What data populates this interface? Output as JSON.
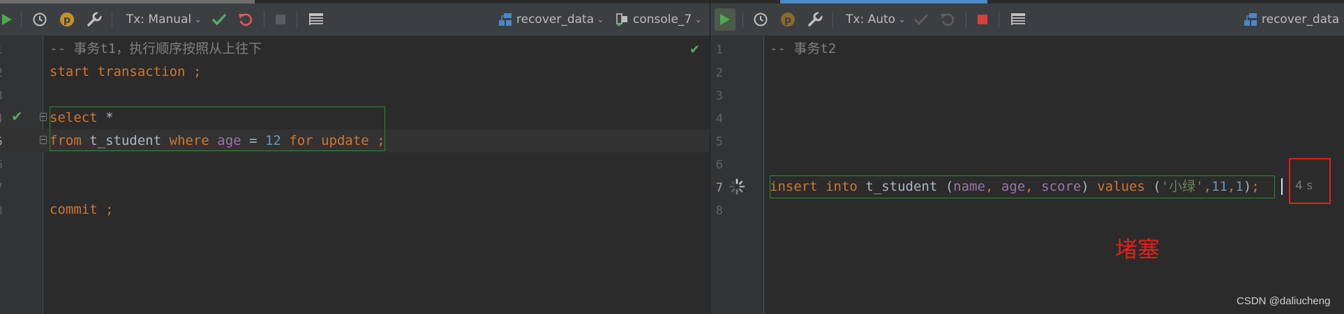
{
  "colors": {
    "editor_bg": "#2b2b2b",
    "toolbar_bg": "#3c3f41",
    "keyword": "#cc7832",
    "column": "#9876aa",
    "number": "#6897bb",
    "string": "#6a8759",
    "comment": "#808080",
    "ok_green": "#59a869",
    "run_green": "#4eaa4e",
    "rollback_red": "#e25757",
    "stop_red": "#d8403b",
    "annotation_red": "#e0201b",
    "active_tab_blue": "#4a88c7"
  },
  "left": {
    "toolbar": {
      "tx_mode": "Tx: Manual",
      "datasource": "recover_data",
      "console": "console_7",
      "icons": [
        "run-icon",
        "history-icon",
        "p-icon",
        "wrench-icon",
        "commit-check-icon",
        "rollback-icon",
        "stop-icon",
        "table-icon",
        "datasource-icon",
        "console-icon",
        "chevron-down-icon"
      ]
    },
    "editor": {
      "line_numbers": [
        "1",
        "2",
        "3",
        "4",
        "5",
        "6",
        "7",
        "8"
      ],
      "comment": "-- 事务t1，执行顺序按照从上往下",
      "line2": {
        "kw1": "start",
        "kw2": "transaction",
        "semi": ";"
      },
      "line4": {
        "kw": "select",
        "star": "*"
      },
      "line5": {
        "kw_from": "from",
        "table": "t_student",
        "kw_where": "where",
        "col": "age",
        "eq": "=",
        "num": "12",
        "kw_for": "for",
        "kw_update": "update",
        "semi": ";"
      },
      "line8": {
        "kw": "commit",
        "semi": ";"
      }
    }
  },
  "right": {
    "toolbar": {
      "tx_mode": "Tx: Auto",
      "datasource": "recover_data",
      "icons": [
        "run-icon",
        "history-icon",
        "p-icon",
        "wrench-icon",
        "commit-check-icon",
        "rollback-icon",
        "stop-icon",
        "table-icon",
        "datasource-icon",
        "chevron-down-icon"
      ]
    },
    "editor": {
      "line_numbers": [
        "1",
        "2",
        "3",
        "4",
        "5",
        "6",
        "7",
        "8"
      ],
      "comment": "-- 事务t2",
      "line7": {
        "kw_insert": "insert",
        "kw_into": "into",
        "table": "t_student",
        "lp": "(",
        "col1": "name",
        "comma1": ",",
        "col2": "age",
        "comma2": ",",
        "col3": "score",
        "rp": ")",
        "kw_values": "values",
        "vlp": "(",
        "str": "'小绿'",
        "c1": ",",
        "n1": "11",
        "c2": ",",
        "n2": "1",
        "vrp": ")",
        "semi": ";"
      },
      "elapsed": "4 s",
      "annotation": "堵塞"
    }
  },
  "watermark": "CSDN @daliucheng"
}
